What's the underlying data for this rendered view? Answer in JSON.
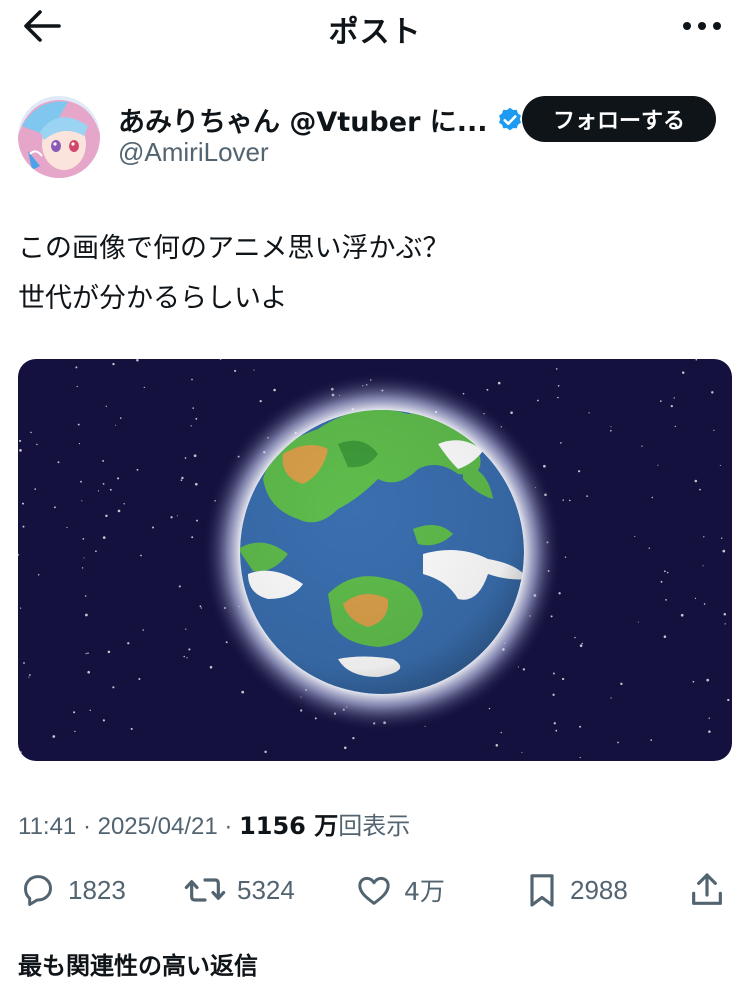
{
  "header": {
    "title": "ポスト",
    "back_icon": "arrow-left-icon",
    "more_icon": "more-horizontal-icon"
  },
  "author": {
    "display_name": "あみりちゃん @Vtuber に...",
    "handle": "@AmiriLover",
    "verified": true,
    "follow_label": "フォローする"
  },
  "post": {
    "lines": [
      "この画像で何のアニメ思い浮かぶ？",
      "世代が分かるらしいよ"
    ],
    "media_description_icon": "earth-image"
  },
  "meta": {
    "time_date": "11:41 · 2025/04/21 · ",
    "views_count": "1156 万",
    "views_label": "回表示"
  },
  "actions": {
    "replies": "1823",
    "reposts": "5324",
    "likes": "4万",
    "bookmarks": "2988"
  },
  "related": {
    "text": "最も関連性の高い返信"
  },
  "colors": {
    "text": "#0f1419",
    "secondary": "#536471",
    "verified": "#1d9bf0",
    "space": "#14113e",
    "ocean": "#3a6fb0",
    "land": "#5fbd4c"
  }
}
